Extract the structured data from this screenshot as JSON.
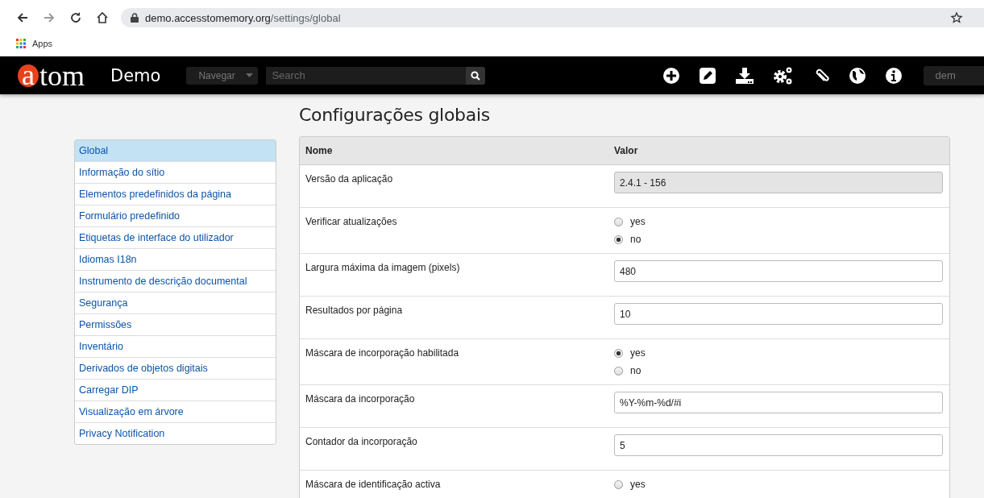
{
  "browser": {
    "url_host": "demo.accesstomemory.org",
    "url_path": "/settings/global",
    "bookmarks": [
      "Apps"
    ]
  },
  "navbar": {
    "logo_initial": "a",
    "logo_rest": "tom",
    "site_name": "Demo",
    "browse_label": "Navegar",
    "search_placeholder": "Search",
    "user_label": "dem"
  },
  "title": "Configurações globais",
  "sidebar": {
    "items": [
      {
        "label": "Global",
        "selected": true
      },
      {
        "label": "Informação do sítio",
        "selected": false
      },
      {
        "label": "Elementos predefinidos da página",
        "selected": false
      },
      {
        "label": "Formulário predefinido",
        "selected": false
      },
      {
        "label": "Etiquetas de interface do utilizador",
        "selected": false
      },
      {
        "label": "Idiomas I18n",
        "selected": false
      },
      {
        "label": "Instrumento de descrição documental",
        "selected": false
      },
      {
        "label": "Segurança",
        "selected": false
      },
      {
        "label": "Permissões",
        "selected": false
      },
      {
        "label": "Inventário",
        "selected": false
      },
      {
        "label": "Derivados de objetos digitais",
        "selected": false
      },
      {
        "label": "Carregar DIP",
        "selected": false
      },
      {
        "label": "Visualização em árvore",
        "selected": false
      },
      {
        "label": "Privacy Notification",
        "selected": false
      }
    ]
  },
  "table": {
    "columns": [
      "Nome",
      "Valor"
    ],
    "rows": [
      {
        "name": "Versão da aplicação",
        "kind": "readonly",
        "value": "2.4.1 - 156"
      },
      {
        "name": "Verificar atualizações",
        "kind": "radio",
        "options": [
          {
            "label": "yes",
            "selected": false
          },
          {
            "label": "no",
            "selected": true
          }
        ]
      },
      {
        "name": "Largura máxima da imagem (pixels)",
        "kind": "text",
        "value": "480"
      },
      {
        "name": "Resultados por página",
        "kind": "text",
        "value": "10"
      },
      {
        "name": "Máscara de incorporação habilitada",
        "kind": "radio",
        "options": [
          {
            "label": "yes",
            "selected": true
          },
          {
            "label": "no",
            "selected": false
          }
        ]
      },
      {
        "name": "Máscara da incorporação",
        "kind": "text",
        "value": "%Y-%m-%d/#i"
      },
      {
        "name": "Contador da incorporação",
        "kind": "text",
        "value": "5"
      },
      {
        "name": "Máscara de identificação activa",
        "kind": "radio",
        "options": [
          {
            "label": "yes",
            "selected": false
          }
        ]
      }
    ]
  }
}
